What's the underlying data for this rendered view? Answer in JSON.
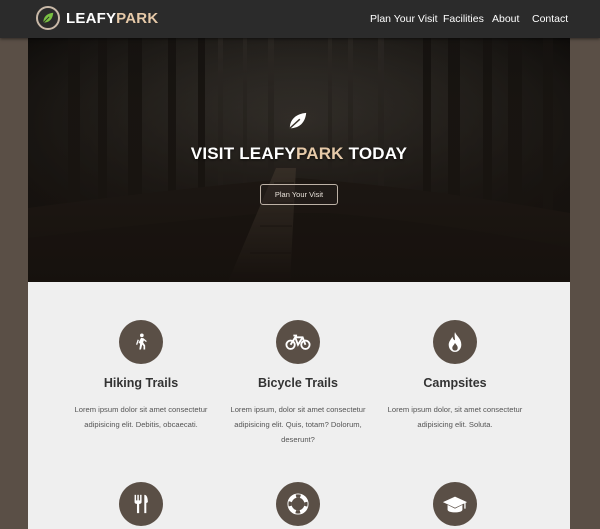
{
  "brand": {
    "name_part1": "LEAFY",
    "name_part2": "PARK"
  },
  "nav": {
    "items": [
      {
        "label": "Plan Your Visit"
      },
      {
        "label": "Facilities"
      },
      {
        "label": "About"
      },
      {
        "label": "Contact"
      }
    ]
  },
  "hero": {
    "title_part1": "VISIT LEAFY",
    "title_highlight": "PARK",
    "title_part2": " TODAY",
    "button_label": "Plan Your Visit"
  },
  "features": [
    {
      "icon": "hiking-icon",
      "title": "Hiking Trails",
      "description": "Lorem ipsum dolor sit amet consectetur adipisicing elit. Debitis, obcaecati."
    },
    {
      "icon": "bicycle-icon",
      "title": "Bicycle Trails",
      "description": "Lorem ipsum, dolor sit amet consectetur adipisicing elit. Quis, totam? Dolorum, deserunt?"
    },
    {
      "icon": "fire-icon",
      "title": "Campsites",
      "description": "Lorem ipsum dolor, sit amet consectetur adipisicing elit. Soluta."
    },
    {
      "icon": "utensils-icon",
      "title": "",
      "description": ""
    },
    {
      "icon": "life-ring-icon",
      "title": "",
      "description": ""
    },
    {
      "icon": "graduation-cap-icon",
      "title": "",
      "description": ""
    }
  ],
  "colors": {
    "page_background": "#5a4f46",
    "navbar": "#2b2b2b",
    "accent": "#e6c9a8",
    "content_background": "#efefef",
    "icon_circle": "#5a4f46"
  }
}
